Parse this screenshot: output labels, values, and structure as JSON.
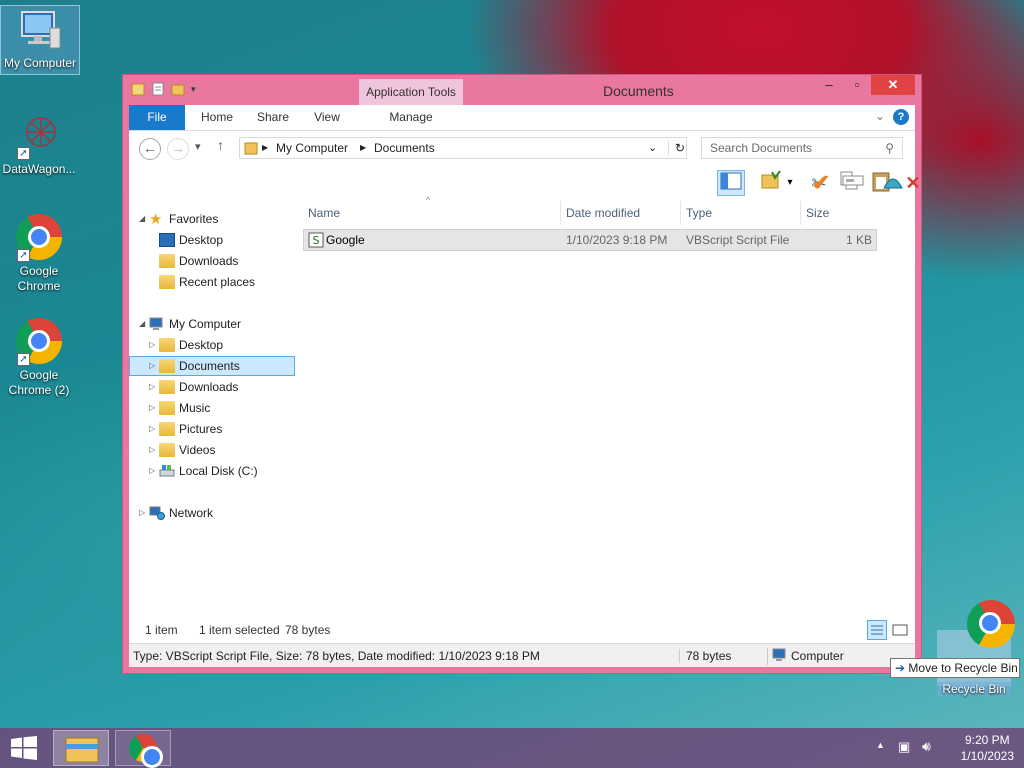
{
  "desktop": {
    "icons": [
      {
        "label": "My Computer"
      },
      {
        "label": "DataWagon..."
      },
      {
        "label": "Google Chrome"
      },
      {
        "label": "Google Chrome (2)"
      }
    ],
    "recycle_bin_label": "Recycle Bin",
    "tooltip": "Move to Recycle Bin"
  },
  "window": {
    "title": "Documents",
    "app_tools": "Application Tools",
    "ribbon_tabs": [
      "File",
      "Home",
      "Share",
      "View",
      "Manage"
    ],
    "help_icon": "?"
  },
  "address": {
    "crumbs": [
      "My Computer",
      "Documents"
    ],
    "search_placeholder": "Search Documents"
  },
  "nav": {
    "favorites": "Favorites",
    "fav_items": [
      "Desktop",
      "Downloads",
      "Recent places"
    ],
    "my_computer": "My Computer",
    "pc_items": [
      "Desktop",
      "Documents",
      "Downloads",
      "Music",
      "Pictures",
      "Videos",
      "Local Disk (C:)"
    ],
    "network": "Network"
  },
  "columns": {
    "name": "Name",
    "date": "Date modified",
    "type": "Type",
    "size": "Size"
  },
  "files": [
    {
      "name": "Google",
      "date": "1/10/2023 9:18 PM",
      "type": "VBScript Script File",
      "size": "1 KB"
    }
  ],
  "status": {
    "count": "1 item",
    "selected": "1 item selected",
    "bytes": "78 bytes",
    "details": "Type: VBScript Script File, Size: 78 bytes, Date modified: 1/10/2023 9:18 PM",
    "detail_size": "78 bytes",
    "detail_location": "Computer"
  },
  "taskbar": {
    "time": "9:20 PM",
    "date": "1/10/2023"
  }
}
